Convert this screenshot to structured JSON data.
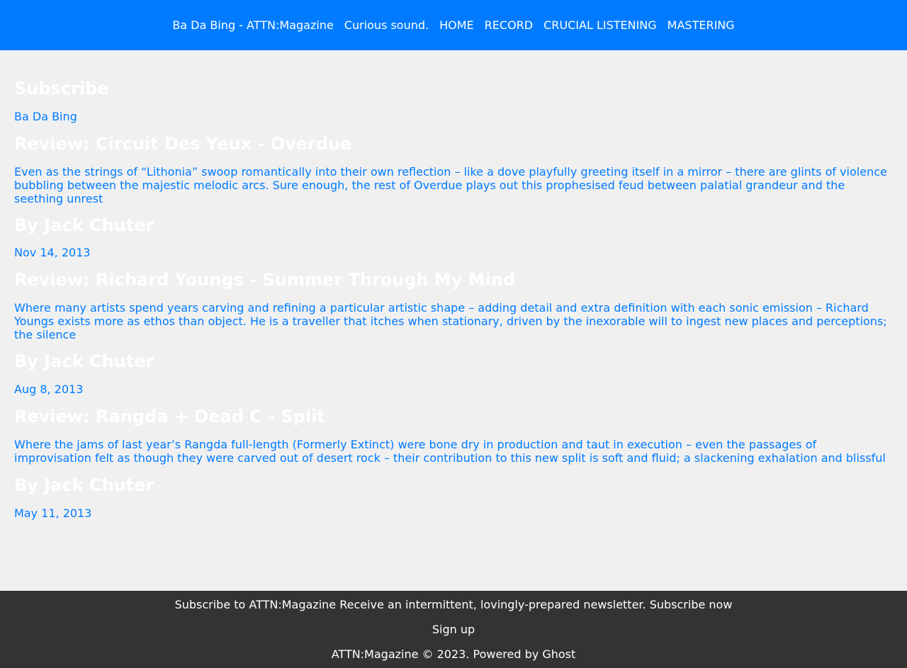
{
  "nav": {
    "brand": "Ba Da Bing - ATTN:Magazine",
    "tagline": "Curious sound.",
    "items": [
      "HOME",
      "RECORD",
      "CRUCIAL LISTENING",
      "MASTERING"
    ]
  },
  "subscribe": {
    "heading": "Subscribe",
    "link": "Ba Da Bing"
  },
  "posts": [
    {
      "title": "Review: Circuit Des Yeux - Overdue",
      "excerpt": "Even as the strings of “Lithonia” swoop romantically into their own reflection – like a dove playfully greeting itself in a mirror – there are glints of violence bubbling between the majestic melodic arcs. Sure enough, the rest of Overdue plays out this prophesised feud between palatial grandeur and the seething unrest",
      "author": "By Jack Chuter",
      "date": "Nov 14, 2013"
    },
    {
      "title": "Review: Richard Youngs - Summer Through My Mind",
      "excerpt": "Where many artists spend years carving and refining a particular artistic shape – adding detail and extra definition with each sonic emission – Richard Youngs exists more as ethos than object. He is a traveller that itches when stationary, driven by the inexorable will to ingest new places and perceptions; the silence",
      "author": "By Jack Chuter",
      "date": "Aug 8, 2013"
    },
    {
      "title": "Review: Rangda + Dead C - Split",
      "excerpt": "Where the jams of last year’s Rangda full-length (Formerly Extinct) were bone dry in production and taut in execution – even the passages of improvisation felt as though they were carved out of desert rock – their contribution to this new split is soft and fluid; a slackening exhalation and blissful",
      "author": "By Jack Chuter",
      "date": "May 11, 2013"
    }
  ],
  "footer": {
    "subscribe_line": "Subscribe to ATTN:Magazine Receive an intermittent, lovingly-prepared newsletter. Subscribe now",
    "signup": "Sign up",
    "copyright": "ATTN:Magazine © 2023. Powered by Ghost"
  },
  "colors": {
    "accent": "#007bff",
    "background": "#f0f0f0",
    "footer": "#333333"
  }
}
